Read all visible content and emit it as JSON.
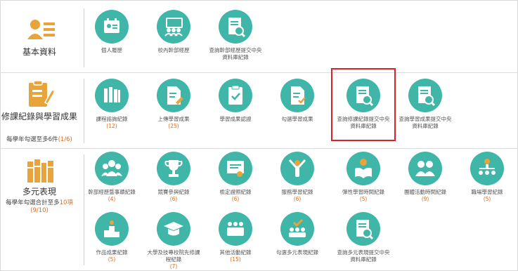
{
  "sections": {
    "basic": {
      "title": "基本資料",
      "items": [
        {
          "label": "個人履歷"
        },
        {
          "label": "校內幹部經歷"
        },
        {
          "label": "查詢幹部經歷提交中央資料庫紀錄"
        }
      ]
    },
    "courses": {
      "title": "修課紀錄與學習成果",
      "note_prefix": "每學年勾選至多",
      "note_limit": "6件",
      "note_count": "(1/6)",
      "items": [
        {
          "label": "課程諮詢紀錄",
          "count": "(12)"
        },
        {
          "label": "上傳學習成果",
          "count": "(25)"
        },
        {
          "label": "學習成果認證"
        },
        {
          "label": "勾選學習成果"
        },
        {
          "label": "查詢修課紀錄提交中央資料庫紀錄"
        },
        {
          "label": "查詢學習成果提交中央資料庫紀錄"
        }
      ]
    },
    "diverse": {
      "title": "多元表現",
      "note_prefix": "每學年勾選合計至多",
      "note_limit": "10項",
      "note_count": "(9/10)",
      "items": [
        {
          "label": "幹部經歷暨事蹟紀錄",
          "count": "(4)"
        },
        {
          "label": "競賽參與紀錄",
          "count": "(6)"
        },
        {
          "label": "檢定證照紀錄",
          "count": "(6)"
        },
        {
          "label": "服務學習紀錄",
          "count": "(6)"
        },
        {
          "label": "彈性學習時間紀錄",
          "count": "(5)"
        },
        {
          "label": "團體活動時間紀錄",
          "count": "(9)"
        },
        {
          "label": "職場學習紀錄",
          "count": "(5)"
        },
        {
          "label": "作品成果紀錄",
          "count": "(5)"
        },
        {
          "label": "大學及技專校院先修課程紀錄",
          "count": "(7)"
        },
        {
          "label": "其他活動紀錄",
          "count": "(15)"
        },
        {
          "label": "勾選多元表現紀錄"
        },
        {
          "label": "查詢多元表現提交中央資料庫紀錄"
        }
      ]
    }
  },
  "colors": {
    "accent": "#3fb6a8",
    "section_icon": "#e8a33a",
    "count": "#e06a1a",
    "highlight_border": "#d9222a"
  }
}
